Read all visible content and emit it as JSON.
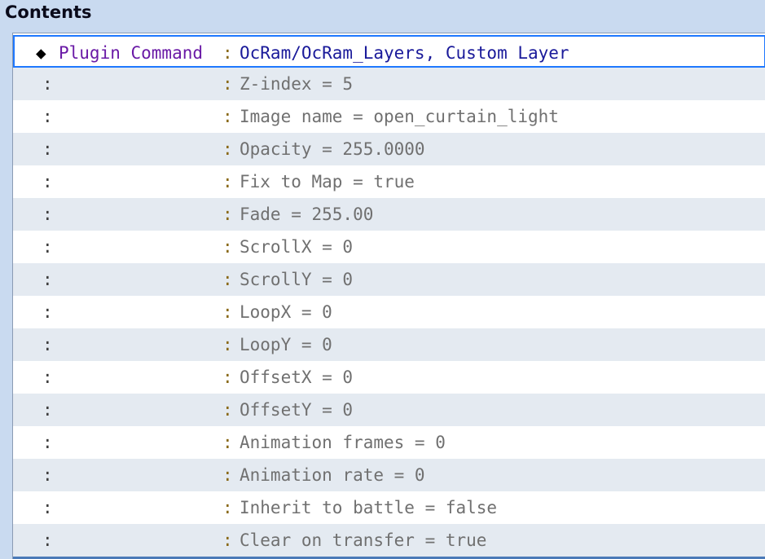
{
  "panel": {
    "title": "Contents"
  },
  "command": {
    "marker": "◆",
    "label": "Plugin Command",
    "separator": ":",
    "value": "OcRam/OcRam_Layers, Custom Layer"
  },
  "params": [
    {
      "indent": ":",
      "separator": ":",
      "text": "Z-index = 5"
    },
    {
      "indent": ":",
      "separator": ":",
      "text": "Image name = open_curtain_light"
    },
    {
      "indent": ":",
      "separator": ":",
      "text": "Opacity = 255.0000"
    },
    {
      "indent": ":",
      "separator": ":",
      "text": "Fix to Map = true"
    },
    {
      "indent": ":",
      "separator": ":",
      "text": "Fade = 255.00"
    },
    {
      "indent": ":",
      "separator": ":",
      "text": "ScrollX = 0"
    },
    {
      "indent": ":",
      "separator": ":",
      "text": "ScrollY = 0"
    },
    {
      "indent": ":",
      "separator": ":",
      "text": "LoopX = 0"
    },
    {
      "indent": ":",
      "separator": ":",
      "text": "LoopY = 0"
    },
    {
      "indent": ":",
      "separator": ":",
      "text": "OffsetX = 0"
    },
    {
      "indent": ":",
      "separator": ":",
      "text": "OffsetY = 0"
    },
    {
      "indent": ":",
      "separator": ":",
      "text": "Animation frames = 0"
    },
    {
      "indent": ":",
      "separator": ":",
      "text": "Animation rate = 0"
    },
    {
      "indent": ":",
      "separator": ":",
      "text": "Inherit to battle = false"
    },
    {
      "indent": ":",
      "separator": ":",
      "text": "Clear on transfer = true"
    }
  ],
  "colors": {
    "header_bg": "#c9daf0",
    "selection_border": "#1e78ff",
    "command_label": "#6a1aa6",
    "command_value": "#1a1a9a",
    "param_text": "#707070",
    "row_alt_bg": "#e4eaf1"
  }
}
